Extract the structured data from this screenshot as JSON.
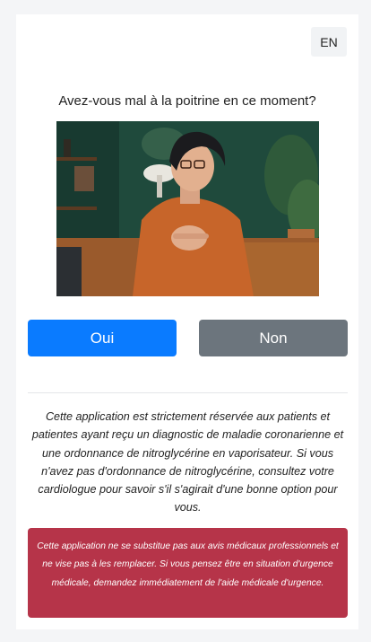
{
  "header": {
    "language_button": "EN"
  },
  "main": {
    "question": "Avez-vous mal à la poitrine en ce moment?",
    "image_icon": "woman-chest-pain-photo",
    "yes_label": "Oui",
    "no_label": "Non",
    "info_text": "Cette application est strictement réservée aux patients et patientes ayant reçu un diagnostic de maladie coronarienne et une ordonnance de nitroglycérine en vaporisateur. Si vous n'avez pas d'ordonnance de nitroglycérine, consultez votre cardiologue pour savoir s'il s'agirait d'une bonne option pour vous.",
    "disclaimer": "Cette application ne se substitue pas aux avis médicaux professionnels et ne vise pas à les remplacer. Si vous pensez être en situation d'urgence médicale, demandez immédiatement de l'aide médicale d'urgence."
  },
  "colors": {
    "primary": "#0a7bff",
    "secondary": "#6c757d",
    "danger": "#b63449"
  }
}
